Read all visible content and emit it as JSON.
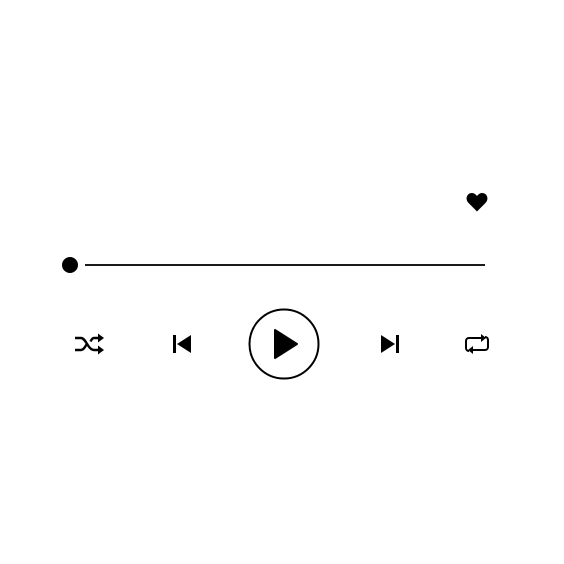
{
  "player": {
    "favorite": {
      "icon": "heart-icon",
      "active": true
    },
    "progress": {
      "fraction": 0.0,
      "track_color": "#1a1a1a",
      "knob_color": "#000000"
    },
    "controls": [
      {
        "id": "shuffle",
        "icon": "shuffle-icon"
      },
      {
        "id": "previous",
        "icon": "skip-previous-icon"
      },
      {
        "id": "play",
        "icon": "play-icon"
      },
      {
        "id": "next",
        "icon": "skip-next-icon"
      },
      {
        "id": "repeat",
        "icon": "repeat-icon"
      }
    ],
    "colors": {
      "foreground": "#000000",
      "background": "#ffffff"
    }
  }
}
